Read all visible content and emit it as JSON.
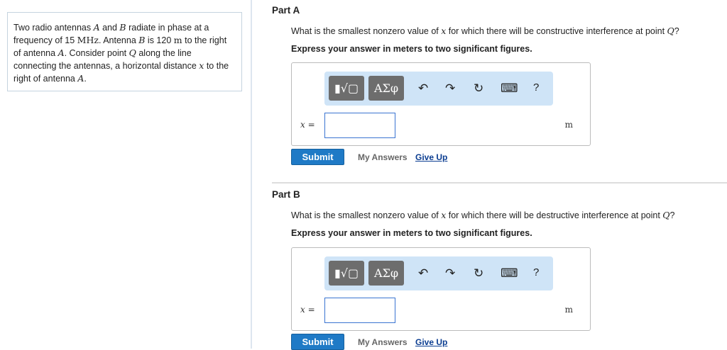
{
  "problem": {
    "t1": "Two radio antennas ",
    "A": "A",
    "t2": " and ",
    "B": "B",
    "t3": " radiate in phase at a frequency of 15 ",
    "MHz": "MHz",
    "t4": ". Antenna ",
    "t5": " is 120 ",
    "mu": "m",
    "t6": " to the right of antenna ",
    "t7": ". Consider point ",
    "Q": "Q",
    "t8": " along the line connecting the antennas, a horizontal distance ",
    "x": "x",
    "t9": " to the right of antenna ",
    "t10": "."
  },
  "parts": [
    {
      "title": "Part A",
      "q1": "What is the smallest nonzero value of ",
      "qx": "x",
      "q2": " for which there will be constructive interference at point ",
      "qQ": "Q",
      "q3": "?",
      "instr": "Express your answer in meters to two significant figures.",
      "var": "x =",
      "value": "",
      "unit": "m",
      "submit": "Submit",
      "my_answers": "My Answers",
      "give_up": "Give Up"
    },
    {
      "title": "Part B",
      "q1": "What is the smallest nonzero value of ",
      "qx": "x",
      "q2": " for which there will be destructive interference at point ",
      "qQ": "Q",
      "q3": "?",
      "instr": "Express your answer in meters to two significant figures.",
      "var": "x =",
      "value": "",
      "unit": "m",
      "submit": "Submit",
      "my_answers": "My Answers",
      "give_up": "Give Up"
    }
  ],
  "toolbar": {
    "symbols": "ΑΣφ",
    "undo": "↶",
    "redo": "↷",
    "reset": "↻",
    "keyboard": "⌨",
    "help": "?"
  }
}
